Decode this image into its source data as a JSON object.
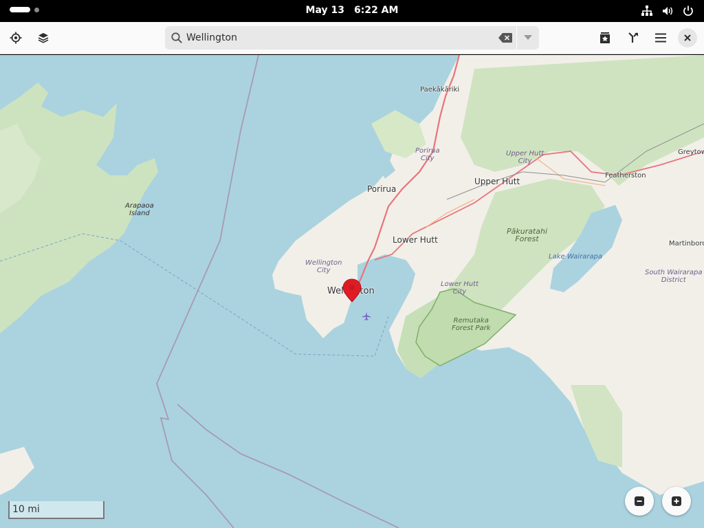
{
  "system_bar": {
    "date": "May 13",
    "time": "6:22 AM",
    "icons": [
      "network-icon",
      "volume-icon",
      "power-icon"
    ]
  },
  "header": {
    "left_buttons": [
      "locate-icon",
      "layers-icon"
    ],
    "search": {
      "value": "Wellington",
      "placeholder": ""
    },
    "right_buttons": [
      "favorites-icon",
      "route-icon",
      "menu-icon",
      "close-icon"
    ]
  },
  "map": {
    "labels": {
      "paekakariki": "Paekākāriki",
      "porirua_city": "Porirua\nCity",
      "porirua": "Porirua",
      "upper_hutt_city": "Upper Hutt\nCity",
      "upper_hutt": "Upper Hutt",
      "featherston": "Featherston",
      "greytown": "Greytow",
      "arapaoa": "Arapaoa\nIsland",
      "lower_hutt": "Lower Hutt",
      "pakuratahi": "Pākuratahi\nForest",
      "lake_wairarapa": "Lake Wairarapa",
      "martinborough": "Martinboro",
      "south_wairarapa": "South Wairarapa\nDistrict",
      "wellington_city": "Wellington\nCity",
      "wellington": "Wellington",
      "lower_hutt_city": "Lower Hutt\nCity",
      "remutaka": "Remutaka\nForest Park"
    },
    "scale_text": "10 mi",
    "colors": {
      "water": "#aad3df",
      "land": "#f2efe9",
      "forest": "#cde3bf",
      "road": "#e8737a",
      "boundary": "#a89ab0",
      "pin": "#e01b24"
    }
  }
}
